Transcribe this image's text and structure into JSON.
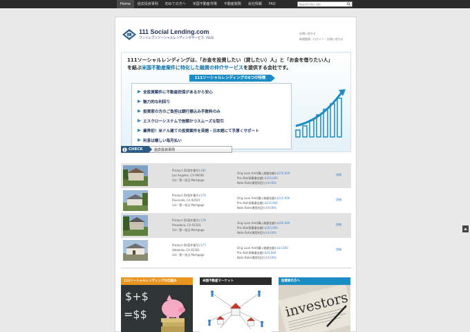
{
  "nav": {
    "items": [
      "Home",
      "過去投資事例",
      "初めての方へ",
      "米国不動産市場",
      "不動産税務",
      "会社情報",
      "FAQ"
    ],
    "active": "Home"
  },
  "search": {
    "placeholder": "Search this site"
  },
  "logo": {
    "title": "111 Social Lending.com",
    "subtitle": "ワンイレブンソーシャルレンディングサービス（SLS）"
  },
  "header_links": {
    "contact": "お問い合わせ",
    "register": "新規登録",
    "login": "ログイン",
    "contact2": "お問い合わせ"
  },
  "banner": {
    "line1": "111ソーシャルレンディングは、「お金を投資したい（貸したい）人」と「お金を借りたい人」",
    "line2_pre": "を結ぶ",
    "line2_hl": "米国不動産案件に特化した融資の仲介サービス",
    "line2_post": "を提供する会社です。",
    "ribbon": "111ソーシャルレンディングの6つの特徴",
    "features": [
      "全投資案件に不動産担保があるから安心",
      "魅力的な利回り",
      "投資家の方のご負担は銀行振込み手数料のみ",
      "エスクローシステムで信頼かつスムーズな取引",
      "業界初！米ドル建ての投資案件を英語・日本語にて手厚くサポート",
      "利息は嬉しい毎月払い"
    ]
  },
  "check": {
    "badge": "CHECK",
    "label": "過去投資事例"
  },
  "cases": [
    {
      "pid_label": "Product ID(案件番号):",
      "pid": "180",
      "city": "Los Angeles, CA 90036",
      "type": "1st／第一抵当 Mortgage",
      "loan_label": "Orig Loan Amt(購入総額金額):",
      "loan": "$370,000",
      "bal_label": "Prin Bal(現事業金額):",
      "bal": "$320,000",
      "rate_label": "Note Rate(運用利回り):",
      "rate": "8.00%",
      "detail": "詳細"
    },
    {
      "pid_label": "Product ID(案件番号):",
      "pid": "179",
      "city": "Riverside, CA 92507",
      "type": "1st／第一抵当 Mortgage",
      "loan_label": "Orig Loan Amt(購入総額金額):",
      "loan": "$115,000",
      "bal_label": "Prin Bal(現事業金額):",
      "bal": "$115,000",
      "rate_label": "Note Rate(運用利回り):",
      "rate": "8.00%",
      "detail": "詳細"
    },
    {
      "pid_label": "Product ID(案件番号):",
      "pid": "178",
      "city": "Pasadena, CA 91103",
      "type": "1st／第一抵当 Mortgage",
      "loan_label": "Orig Loan Amt(購入総額金額):",
      "loan": "$165,000",
      "bal_label": "Prin Bal(現事業金額):",
      "bal": "$165,000",
      "rate_label": "Note Rate(運用利回り):",
      "rate": "8.00%",
      "detail": "詳細"
    },
    {
      "pid_label": "Product ID(案件番号):",
      "pid": "177",
      "city": "Adelanto, CA 92301",
      "type": "1st／第一抵当 Mortgage",
      "loan_label": "Orig Loan Amt(購入総額金額):",
      "loan": "$33,000",
      "bal_label": "Prin Bal(現事業金額):",
      "bal": "$33,000",
      "rate_label": "Note Rate(運用利回り):",
      "rate": "8.00%",
      "detail": "詳細"
    }
  ],
  "boxes": [
    {
      "title": "111ソーシャルレンディングの仕組み",
      "color": "#e8961e"
    },
    {
      "title": "米国不動産マーケット",
      "color": "#2b2b2b"
    },
    {
      "title": "投資家の方へ",
      "color": "#1b8cc4"
    }
  ],
  "colors": {
    "accent": "#1b8cc4",
    "navy": "#1c2f55",
    "link": "#3b7fc4"
  }
}
